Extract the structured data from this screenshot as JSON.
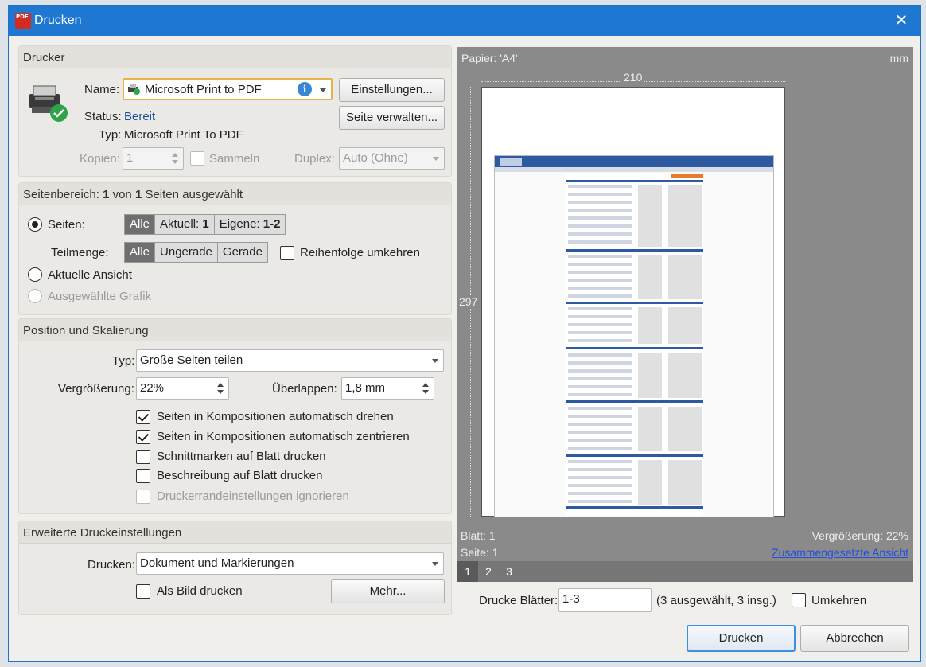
{
  "window": {
    "title": "Drucken",
    "close_glyph": "✕",
    "icon_text": "PDF"
  },
  "printer": {
    "section_title": "Drucker",
    "name_label": "Name:",
    "name_value": "Microsoft Print to PDF",
    "settings_button": "Einstellungen...",
    "status_label": "Status:",
    "status_value": "Bereit",
    "manage_page_button": "Seite verwalten...",
    "type_label": "Typ:",
    "type_value": "Microsoft Print To PDF",
    "copies_label": "Kopien:",
    "copies_value": "1",
    "collate_label": "Sammeln",
    "duplex_label": "Duplex:",
    "duplex_value": "Auto (Ohne)"
  },
  "range": {
    "title_parts": [
      "Seitenbereich: ",
      "1",
      " von ",
      "1",
      " Seiten ausgewählt"
    ],
    "pages_label": "Seiten:",
    "pages_options": [
      "Alle",
      "Aktuell: ",
      "1",
      "Eigene: ",
      "1-2"
    ],
    "subset_label": "Teilmenge:",
    "subset_options": [
      "Alle",
      "Ungerade",
      "Gerade"
    ],
    "reverse_label": "Reihenfolge umkehren",
    "current_view_label": "Aktuelle Ansicht",
    "selected_graphic_label": "Ausgewählte Grafik"
  },
  "scaling": {
    "section_title": "Position und Skalierung",
    "type_label": "Typ:",
    "type_value": "Große Seiten teilen",
    "zoom_label": "Vergrößerung:",
    "zoom_value": "22%",
    "overlap_label": "Überlappen:",
    "overlap_value": "1,8 mm",
    "options": [
      {
        "label": "Seiten in Kompositionen automatisch drehen",
        "checked": true,
        "enabled": true
      },
      {
        "label": "Seiten in Kompositionen automatisch zentrieren",
        "checked": true,
        "enabled": true
      },
      {
        "label": "Schnittmarken auf Blatt drucken",
        "checked": false,
        "enabled": true
      },
      {
        "label": "Beschreibung auf Blatt drucken",
        "checked": false,
        "enabled": true
      },
      {
        "label": "Druckerrandeinstellungen ignorieren",
        "checked": false,
        "enabled": false
      }
    ]
  },
  "advanced": {
    "section_title": "Erweiterte Druckeinstellungen",
    "print_label": "Drucken:",
    "print_value": "Dokument und Markierungen",
    "as_image_label": "Als Bild drucken",
    "more_button": "Mehr..."
  },
  "preview": {
    "paper_label": "Papier: 'A4'",
    "unit_label": "mm",
    "width_value": "210",
    "height_value": "297",
    "sheet_label": "Blatt: 1",
    "page_label": "Seite: 1",
    "zoom_text": "Vergrößerung: 22%",
    "composite_link": "Zusammengesetzte Ansicht",
    "page_tabs": [
      "1",
      "2",
      "3"
    ],
    "selected_tab": 0
  },
  "sheets": {
    "label": "Drucke Blätter:",
    "value": "1-3",
    "info": "(3 ausgewählt, 3 insg.)",
    "reverse_label": "Umkehren"
  },
  "buttons": {
    "print": "Drucken",
    "cancel": "Abbrechen"
  },
  "colors": {
    "titlebar": "#1e78d2",
    "accent": "#1a4f9c",
    "link": "#1f4fe0"
  }
}
